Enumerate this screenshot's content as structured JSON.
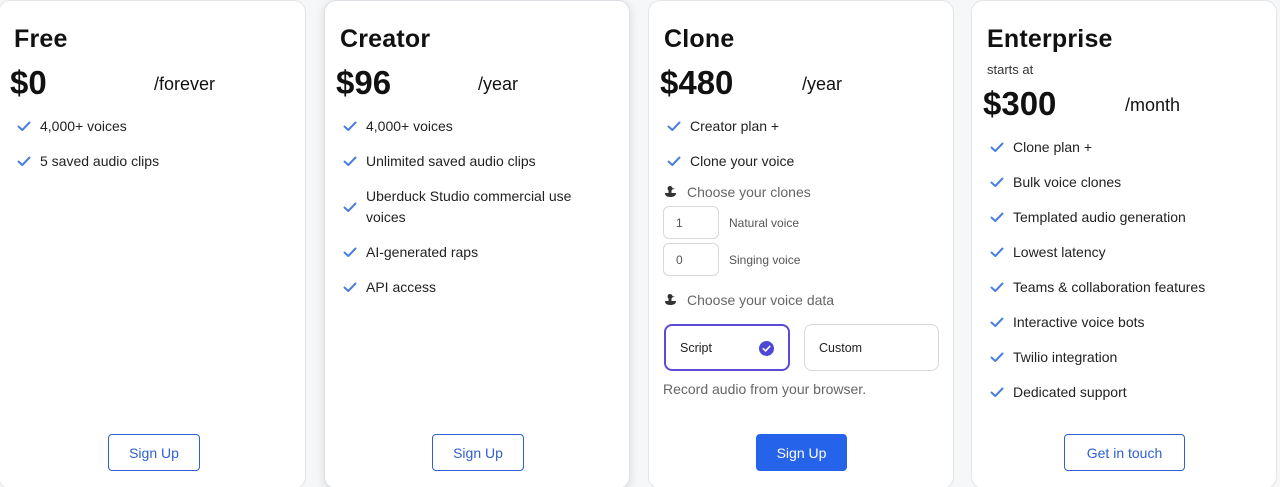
{
  "colors": {
    "accent": "#2563eb",
    "check": "#4a7fe0",
    "selected_border": "#5b4bd6"
  },
  "plans": {
    "free": {
      "name": "Free",
      "price": "$0",
      "period": "/forever",
      "features": [
        "4,000+ voices",
        "5 saved audio clips"
      ],
      "cta": "Sign Up"
    },
    "creator": {
      "name": "Creator",
      "price": "$96",
      "period": "/year",
      "features": [
        "4,000+ voices",
        "Unlimited saved audio clips",
        "Uberduck Studio commercial use voices",
        "AI-generated raps",
        "API access"
      ],
      "cta": "Sign Up"
    },
    "clone": {
      "name": "Clone",
      "price": "$480",
      "period": "/year",
      "features": [
        "Creator plan +",
        "Clone your voice"
      ],
      "clones_heading": "Choose your clones",
      "natural": {
        "value": "1",
        "label": "Natural voice"
      },
      "singing": {
        "value": "0",
        "label": "Singing voice"
      },
      "data_heading": "Choose your voice data",
      "options": {
        "script": "Script",
        "custom": "Custom",
        "selected": "Script"
      },
      "note": "Record audio from your browser.",
      "cta": "Sign Up"
    },
    "enterprise": {
      "name": "Enterprise",
      "starts": "starts at",
      "price": "$300",
      "period": "/month",
      "features": [
        "Clone plan +",
        "Bulk voice clones",
        "Templated audio generation",
        "Lowest latency",
        "Teams & collaboration features",
        "Interactive voice bots",
        "Twilio integration",
        "Dedicated support"
      ],
      "cta": "Get in touch"
    }
  }
}
